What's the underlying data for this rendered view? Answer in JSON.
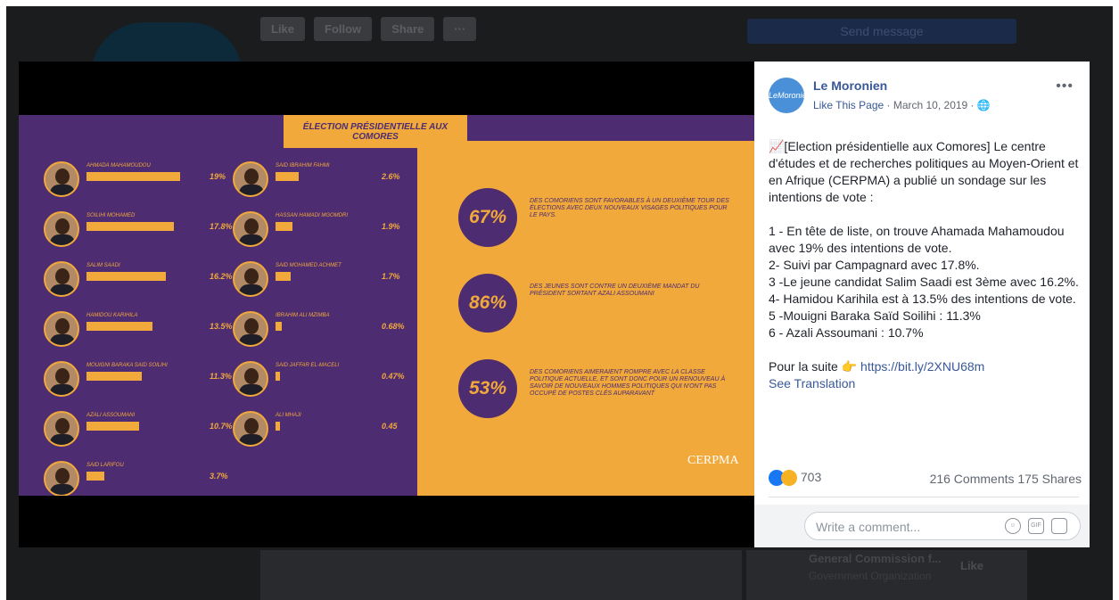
{
  "background": {
    "buttons": [
      "Like",
      "Follow",
      "Share",
      "···"
    ],
    "send_message": "Send message",
    "page_name": "General Commission f...",
    "page_category": "Government Organization",
    "like_label": "Like"
  },
  "poster": {
    "title": "ÉLECTION PRÉSIDENTIELLE AUX COMORES",
    "candidates_left": [
      {
        "name": "AHMADA MAHAMOUDOU",
        "value": 19,
        "label": "19%"
      },
      {
        "name": "SOILIHI MOHAMED",
        "value": 17.8,
        "label": "17.8%"
      },
      {
        "name": "SALIM SAADI",
        "value": 16.2,
        "label": "16.2%"
      },
      {
        "name": "HAMIDOU KARIHILA",
        "value": 13.5,
        "label": "13.5%"
      },
      {
        "name": "MOUIGNI BARAKA SAID SOILIHI",
        "value": 11.3,
        "label": "11.3%"
      },
      {
        "name": "AZALI ASSOUMANI",
        "value": 10.7,
        "label": "10.7%"
      },
      {
        "name": "SAID LARIFOU",
        "value": 3.7,
        "label": "3.7%"
      }
    ],
    "candidates_right": [
      {
        "name": "SAID IBRAHIM FAHMI",
        "value": 2.6,
        "label": "2.6%"
      },
      {
        "name": "HASSAN HAMADI MGOMDRI",
        "value": 1.9,
        "label": "1.9%"
      },
      {
        "name": "SAID MOHAMED ACHMET",
        "value": 1.7,
        "label": "1.7%"
      },
      {
        "name": "IBRAHIM ALI MZIMBA",
        "value": 0.68,
        "label": "0.68%"
      },
      {
        "name": "SAID JAFFAR EL-MACELI",
        "value": 0.47,
        "label": "0.47%"
      },
      {
        "name": "ALI MHAJI",
        "value": 0.45,
        "label": "0.45"
      }
    ],
    "stats": [
      {
        "pct": "67%",
        "text": "DES COMORIENS SONT FAVORABLES À UN DEUXIÈME TOUR DES ÉLECTIONS AVEC DEUX NOUVEAUX VISAGES POLITIQUES POUR LE PAYS."
      },
      {
        "pct": "86%",
        "text": "DES JEUNES SONT CONTRE UN DEUXIÈME MANDAT DU PRÉSIDENT SORTANT AZALI ASSOUMANI"
      },
      {
        "pct": "53%",
        "text": "DES COMORIENS AIMERAIENT ROMPRE AVEC LA CLASSE POLITIQUE ACTUELLE, ET SONT DONC POUR UN RENOUVEAU À SAVOIR DE NOUVEAUX HOMMES POLITIQUES QUI N'ONT PAS OCCUPÉ DE POSTES CLÉS AUPARAVANT"
      }
    ],
    "logo": "CERPMA"
  },
  "post": {
    "avatar_text": "LeMoronien",
    "page_name": "Le Moronien",
    "like_page": "Like This Page",
    "date": " · March 10, 2019 · ",
    "globe_icon": "globe-icon",
    "more": "•••",
    "lines": [
      "📈[Election présidentielle aux Comores] Le centre d'études et de recherches politiques au Moyen-Orient et en Afrique (CERPMA) a publié un sondage sur les intentions de vote :",
      "",
      "1 - En tête de liste, on trouve Ahamada Mahamoudou avec 19% des intentions de vote.",
      "2- Suivi par Campagnard avec 17.8%.",
      "3 -Le jeune candidat Salim Saadi est 3ème avec 16.2%.",
      "4- Hamidou Karihila est à 13.5% des intentions de vote.",
      "5 -Mouigni Baraka Saïd Soilihi : 11.3%",
      "6 - Azali Assoumani : 10.7%",
      ""
    ],
    "suite_label": "Pour la suite 👉 ",
    "suite_link": "https://bit.ly/2XNU68m",
    "see_translation": "See Translation",
    "reaction_count": "703",
    "comments": "216 Comments",
    "shares": "175 Shares",
    "comment_placeholder": "Write a comment..."
  },
  "colors": {
    "purple": "#4e2c72",
    "orange": "#f0a93a",
    "fb_blue": "#385898"
  }
}
